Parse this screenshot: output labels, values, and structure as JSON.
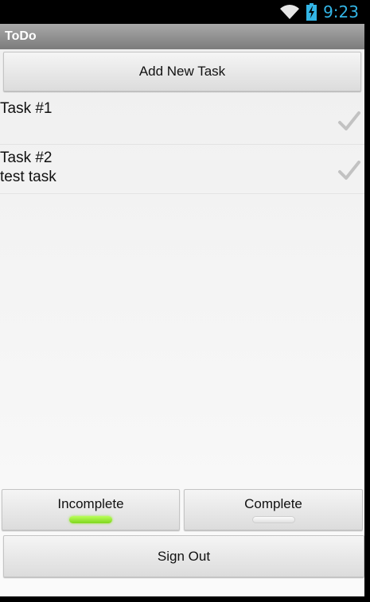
{
  "status_bar": {
    "time": "9:23",
    "icons": [
      "wifi-icon",
      "battery-charging-icon"
    ],
    "accent_color": "#33b5e5"
  },
  "app": {
    "title": "ToDo"
  },
  "actions": {
    "add_task_label": "Add New Task",
    "sign_out_label": "Sign Out"
  },
  "tasks": [
    {
      "title": "Task #1",
      "description": "",
      "icon": "check-icon"
    },
    {
      "title": "Task #2",
      "description": "test task",
      "icon": "check-icon"
    }
  ],
  "filters": {
    "incomplete_label": "Incomplete",
    "complete_label": "Complete",
    "active": "Incomplete",
    "active_indicator_color": "#8ee02a"
  }
}
